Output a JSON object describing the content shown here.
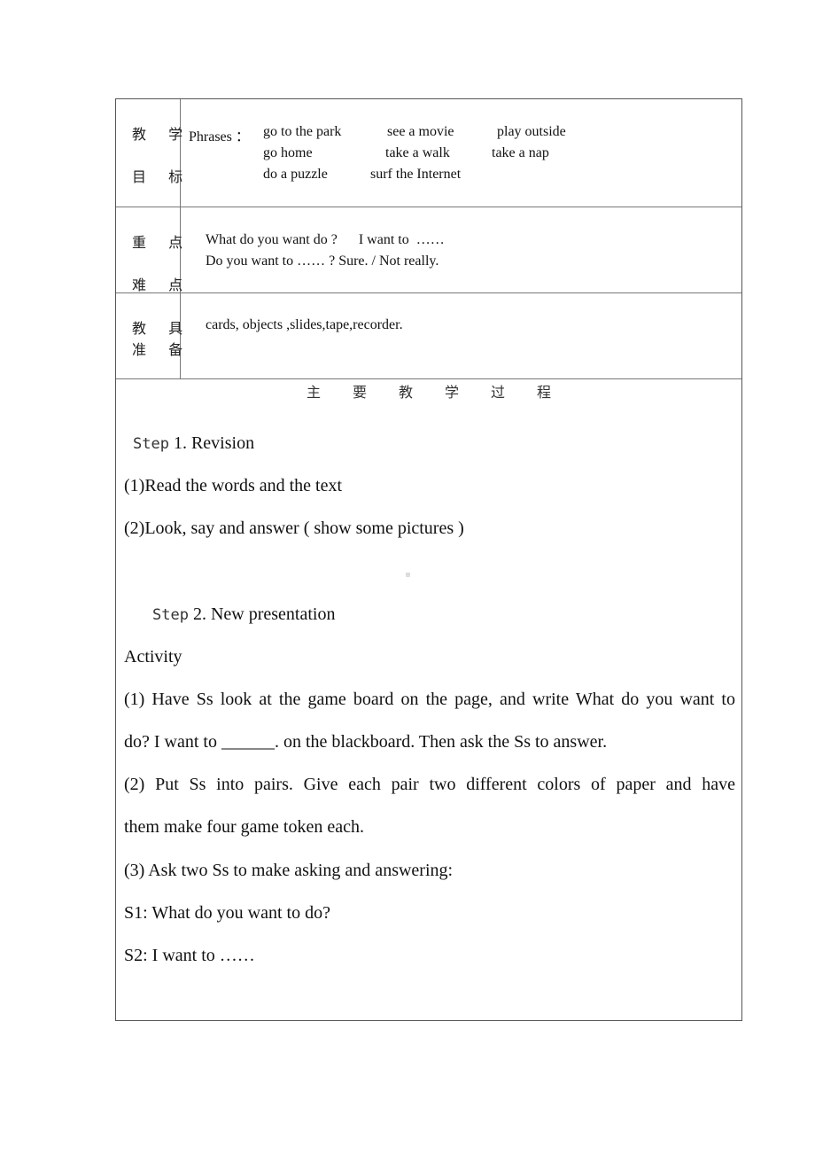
{
  "table": {
    "rows": [
      {
        "label_lines": [
          "教 学",
          "目 标"
        ],
        "phrases_label": "Phrases ：",
        "phrases": [
          [
            "go to the park",
            "see a movie",
            "play outside"
          ],
          [
            "go home",
            "take a walk",
            "take a nap"
          ],
          [
            "do a puzzle",
            "surf the Internet"
          ]
        ]
      },
      {
        "label_lines": [
          "重 点",
          "难 点"
        ],
        "lines": [
          "What do you want do ?      I want to  ……",
          "Do you want to …… ? Sure. / Not really."
        ]
      },
      {
        "label_lines": [
          "教 具",
          "准 备"
        ],
        "lines": [
          "cards, objects ,slides,tape,recorder."
        ]
      }
    ],
    "process": {
      "heading_chars": [
        "主",
        "要",
        "教",
        "学",
        "过",
        "程"
      ],
      "step1": {
        "prefix": "Step",
        "title": "1. Revision"
      },
      "step1_items": [
        "(1)Read the words and the text",
        "(2)Look, say and answer ( show some pictures )"
      ],
      "step2": {
        "prefix": "Step",
        "title": "2. New presentation"
      },
      "activity_label": "Activity",
      "activity_lines": [
        "(1) Have Ss look at the game board on the page, and write What do you want to",
        "do? I want to ______. on the blackboard. Then ask the Ss to answer.",
        "(2) Put Ss into pairs. Give each pair two different colors of paper and have",
        "them make four game token each.",
        "(3) Ask two Ss to make asking and answering:",
        "S1: What do you want to do?",
        "S2: I want to ……"
      ]
    }
  }
}
